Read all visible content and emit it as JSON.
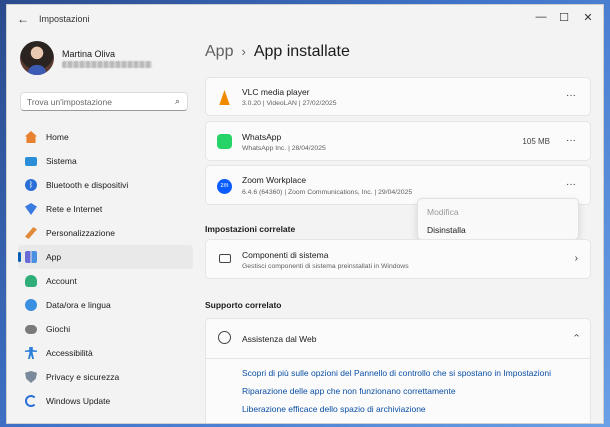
{
  "window": {
    "title": "Impostazioni"
  },
  "user": {
    "name": "Martina Oliva"
  },
  "search": {
    "placeholder": "Trova un'impostazione"
  },
  "sidebar": {
    "items": [
      {
        "label": "Home",
        "icon": "home-icon",
        "color": "#e8822e"
      },
      {
        "label": "Sistema",
        "icon": "monitor-icon",
        "color": "#2a8fd8"
      },
      {
        "label": "Bluetooth e dispositivi",
        "icon": "bluetooth-icon",
        "color": "#2a6fd8"
      },
      {
        "label": "Rete e Internet",
        "icon": "wifi-icon",
        "color": "#3a7be0"
      },
      {
        "label": "Personalizzazione",
        "icon": "brush-icon",
        "color": "#e08a3a"
      },
      {
        "label": "App",
        "icon": "apps-icon",
        "color": "#6b6bd8"
      },
      {
        "label": "Account",
        "icon": "person-icon",
        "color": "#2fae7a"
      },
      {
        "label": "Data/ora e lingua",
        "icon": "globe-clock-icon",
        "color": "#3a8fe0"
      },
      {
        "label": "Giochi",
        "icon": "gamepad-icon",
        "color": "#7a7a7a"
      },
      {
        "label": "Accessibilità",
        "icon": "accessibility-icon",
        "color": "#2a7fd8"
      },
      {
        "label": "Privacy e sicurezza",
        "icon": "shield-icon",
        "color": "#7a8a9a"
      },
      {
        "label": "Windows Update",
        "icon": "update-icon",
        "color": "#2a6fd8"
      }
    ]
  },
  "breadcrumb": {
    "parent": "App",
    "separator": "›",
    "current": "App installate"
  },
  "apps": [
    {
      "name": "VLC media player",
      "meta": "3.0.20  |  VideoLAN  |  27/02/2025",
      "size": "",
      "icon": "vlc-icon",
      "color": "#f08a00"
    },
    {
      "name": "WhatsApp",
      "meta": "WhatsApp Inc.  |  28/04/2025",
      "size": "105 MB",
      "icon": "whatsapp-icon",
      "color": "#25d366"
    },
    {
      "name": "Zoom Workplace",
      "meta": "6.4.6 (64360)  |  Zoom Communications, Inc.  |  29/04/2025",
      "size": "",
      "icon": "zoom-icon",
      "color": "#0b5cff"
    }
  ],
  "more_label": "···",
  "context_menu": {
    "items": [
      {
        "label": "Modifica",
        "disabled": true
      },
      {
        "label": "Disinstalla",
        "disabled": false
      }
    ]
  },
  "related_settings": {
    "title": "Impostazioni correlate",
    "component": {
      "title": "Componenti di sistema",
      "subtitle": "Gestisci componenti di sistema preinstallati in Windows"
    }
  },
  "related_support": {
    "title": "Supporto correlato",
    "web_help": {
      "title": "Assistenza dal Web"
    },
    "links": [
      "Scopri di più sulle opzioni del Pannello di controllo che si spostano in Impostazioni",
      "Riparazione delle app che non funzionano correttamente",
      "Liberazione efficace dello spazio di archiviazione"
    ]
  }
}
